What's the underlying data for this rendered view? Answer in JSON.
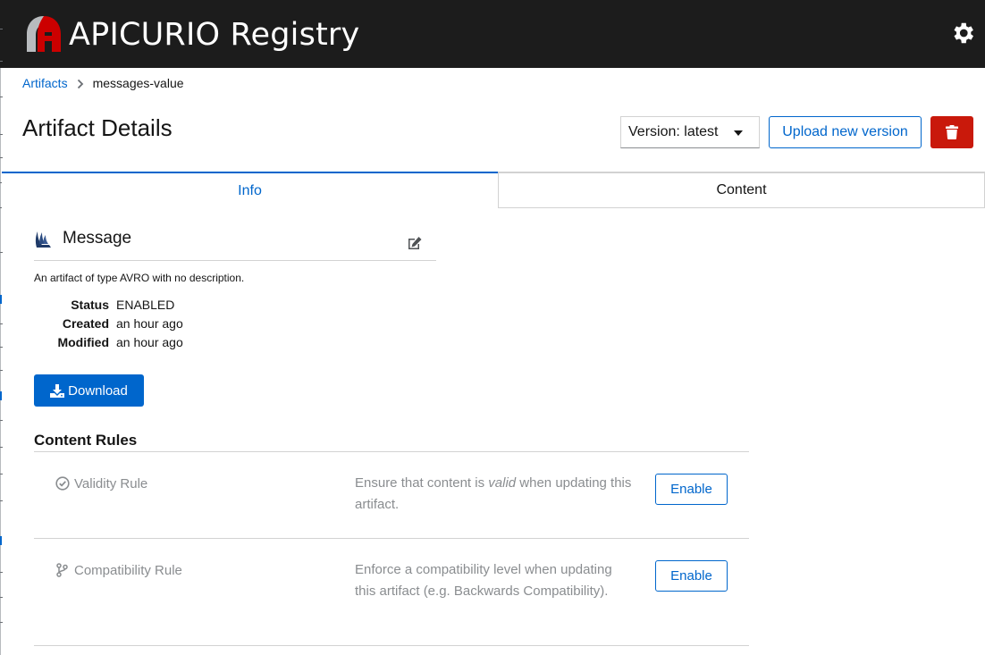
{
  "app": {
    "brand": "APICURIO Registry",
    "colors": {
      "header_bg": "#1c1c1c",
      "accent": "#0066cc",
      "danger": "#c9190b",
      "logo_red": "#cc0000"
    }
  },
  "breadcrumb": {
    "root": "Artifacts",
    "current": "messages-value"
  },
  "page": {
    "title": "Artifact Details"
  },
  "toolbar": {
    "version_label": "Version: latest",
    "upload_label": "Upload new version"
  },
  "tabs": [
    {
      "label": "Info"
    },
    {
      "label": "Content"
    }
  ],
  "artifact": {
    "name": "Message",
    "description": "An artifact of type AVRO with no description.",
    "meta": [
      {
        "label": "Status",
        "value": "ENABLED"
      },
      {
        "label": "Created",
        "value": "an hour ago"
      },
      {
        "label": "Modified",
        "value": "an hour ago"
      }
    ],
    "download_label": "Download"
  },
  "rules": {
    "title": "Content Rules",
    "items": [
      {
        "name": "Validity Rule",
        "desc_pre": "Ensure that content is ",
        "desc_em": "valid",
        "desc_post": " when updating this artifact.",
        "button": "Enable",
        "icon": "check-circle-icon"
      },
      {
        "name": "Compatibility Rule",
        "desc_pre": "Enforce a compatibility level when updating this artifact (e.g. Backwards Compatibility).",
        "desc_em": "",
        "desc_post": "",
        "button": "Enable",
        "icon": "code-branch-icon"
      }
    ]
  }
}
